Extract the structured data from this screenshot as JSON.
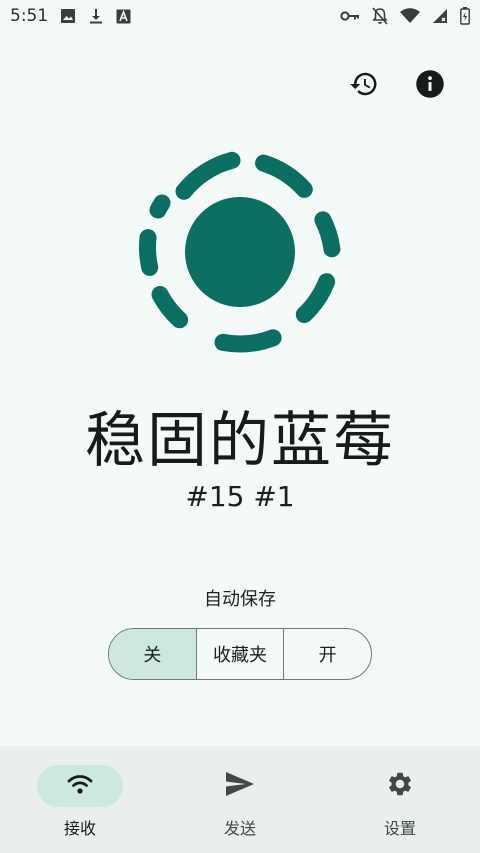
{
  "status_bar": {
    "time": "5:51",
    "left_icons": [
      "image-icon",
      "download-icon",
      "a-box-icon"
    ],
    "right_icons": [
      "key-icon",
      "bell-off-icon",
      "wifi-icon",
      "signal-icon",
      "battery-icon"
    ]
  },
  "top_actions": {
    "history_icon": "history-icon",
    "info_icon": "info-icon"
  },
  "colors": {
    "accent": "#0b6e63",
    "background": "#f4faf8",
    "selected": "#cce8e1",
    "nav_background": "#e8efec"
  },
  "device": {
    "name": "稳固的蓝莓",
    "tag": "#15 #1"
  },
  "autosave": {
    "label": "自动保存",
    "options": [
      "关",
      "收藏夹",
      "开"
    ],
    "selected": "关"
  },
  "bottom_nav": {
    "items": [
      {
        "label": "接收",
        "icon": "wifi-icon",
        "active": true
      },
      {
        "label": "发送",
        "icon": "send-icon",
        "active": false
      },
      {
        "label": "设置",
        "icon": "gear-icon",
        "active": false
      }
    ]
  }
}
